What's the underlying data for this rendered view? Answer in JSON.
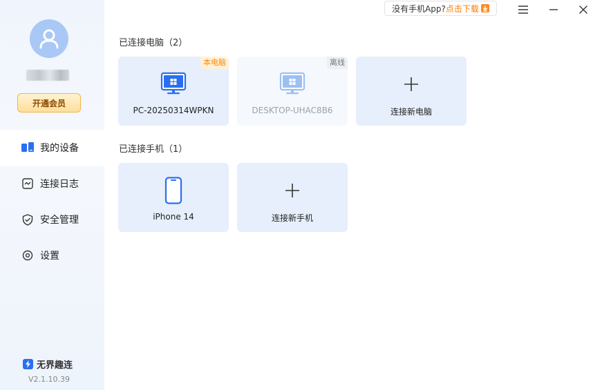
{
  "sidebar": {
    "vip_label": "开通会员",
    "items": [
      {
        "label": "我的设备",
        "icon": "devices-icon",
        "active": true
      },
      {
        "label": "连接日志",
        "icon": "log-icon",
        "active": false
      },
      {
        "label": "安全管理",
        "icon": "shield-icon",
        "active": false
      },
      {
        "label": "设置",
        "icon": "settings-icon",
        "active": false
      }
    ],
    "brand": "无界趣连",
    "version": "V2.1.10.39"
  },
  "topbar": {
    "promo_question": "没有手机App?",
    "promo_link": "点击下载"
  },
  "pcs": {
    "title": "已连接电脑（2）",
    "devices": [
      {
        "name": "PC-20250314WPKN",
        "tag": "本电脑"
      },
      {
        "name": "DESKTOP-UHAC8B6",
        "tag": "离线"
      }
    ],
    "add_label": "连接新电脑"
  },
  "phones": {
    "title": "已连接手机（1）",
    "devices": [
      {
        "name": "iPhone 14"
      }
    ],
    "add_label": "连接新手机"
  },
  "colors": {
    "accent": "#2a6ff0",
    "card_bg": "#e6effb",
    "vip_border": "#f0b54a",
    "download_orange": "#ff7a00"
  }
}
